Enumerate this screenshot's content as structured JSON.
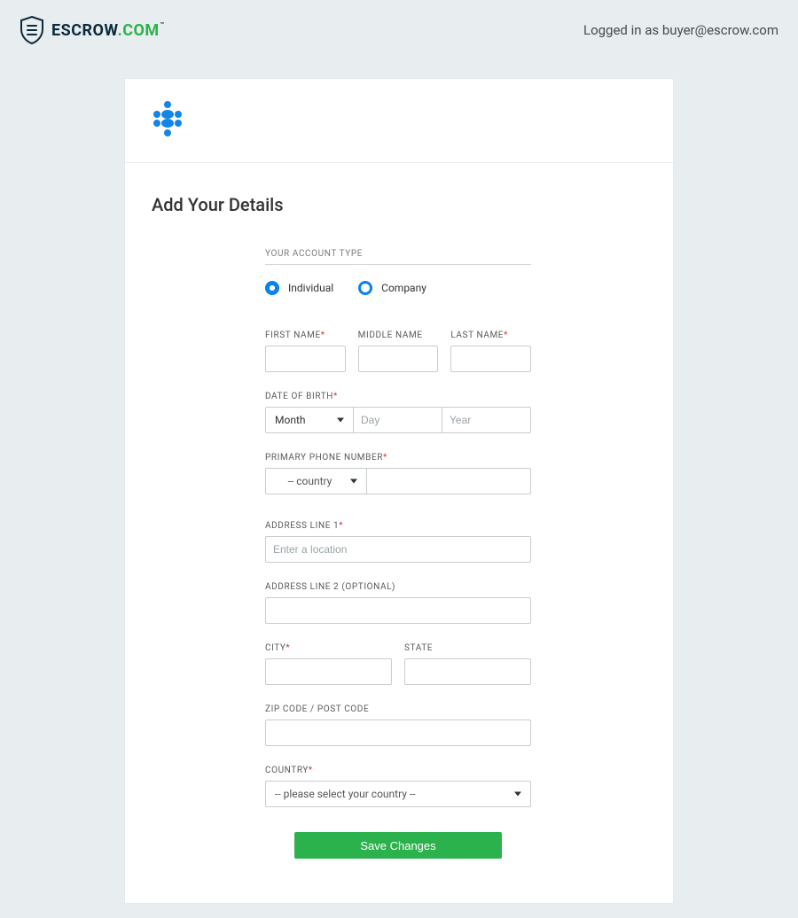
{
  "header": {
    "brand_escrow": "ESCROW",
    "brand_dot": ".COM",
    "login_status": "Logged in as buyer@escrow.com"
  },
  "page": {
    "title": "Add Your Details",
    "section_account_type": "YOUR ACCOUNT TYPE"
  },
  "account_type": {
    "individual": "Individual",
    "company": "Company"
  },
  "labels": {
    "first_name": "FIRST NAME",
    "middle_name": "MIDDLE NAME",
    "last_name": "LAST NAME",
    "dob": "DATE OF BIRTH",
    "phone": "PRIMARY PHONE NUMBER",
    "address1": "ADDRESS LINE 1",
    "address2": "ADDRESS LINE 2 (OPTIONAL)",
    "city": "CITY",
    "state": "STATE",
    "zip": "ZIP CODE / POST CODE",
    "country": "COUNTRY"
  },
  "placeholders": {
    "month": "Month",
    "day": "Day",
    "year": "Year",
    "phone_country": "-- country",
    "address1": "Enter a location",
    "country_select": "-- please select your country --"
  },
  "buttons": {
    "save": "Save Changes"
  }
}
